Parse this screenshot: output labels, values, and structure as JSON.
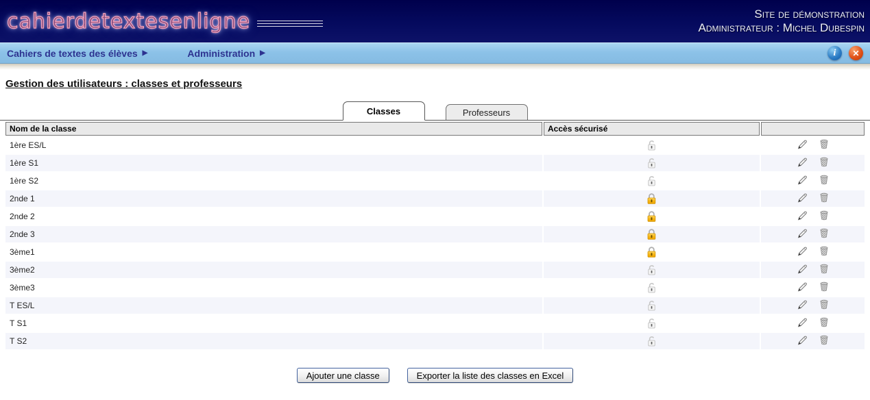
{
  "header": {
    "logo": "cahierdetextesenligne",
    "site_label": "Site de démonstration",
    "admin_label": "Administrateur : Michel Dubespin"
  },
  "menu": {
    "items": [
      {
        "label": "Cahiers de textes des élèves",
        "arrow": "▶"
      },
      {
        "label": "Administration",
        "arrow": "▶"
      }
    ],
    "icons": [
      {
        "name": "info-icon",
        "glyph": "i"
      },
      {
        "name": "close-icon",
        "glyph": "✕"
      }
    ]
  },
  "page": {
    "title": "Gestion des utilisateurs : classes et professeurs"
  },
  "tabs": [
    {
      "label": "Classes",
      "active": true
    },
    {
      "label": "Professeurs",
      "active": false
    }
  ],
  "table": {
    "columns": [
      "Nom de la classe",
      "Accès sécurisé",
      ""
    ],
    "icons": {
      "secured": "lock-closed-icon",
      "unsecured": "lock-open-icon",
      "edit": "edit-pencil-icon",
      "delete": "trash-icon"
    },
    "rows": [
      {
        "name": "1ère ES/L",
        "secured": false
      },
      {
        "name": "1ère S1",
        "secured": false
      },
      {
        "name": "1ère S2",
        "secured": false
      },
      {
        "name": "2nde 1",
        "secured": true
      },
      {
        "name": "2nde 2",
        "secured": true
      },
      {
        "name": "2nde 3",
        "secured": true
      },
      {
        "name": "3ème1",
        "secured": true
      },
      {
        "name": "3ème2",
        "secured": false
      },
      {
        "name": "3ème3",
        "secured": false
      },
      {
        "name": "T ES/L",
        "secured": false
      },
      {
        "name": "T S1",
        "secured": false
      },
      {
        "name": "T S2",
        "secured": false
      }
    ]
  },
  "buttons": {
    "add": "Ajouter une classe",
    "export": "Exporter la liste des classes en Excel"
  },
  "colors": {
    "header_navy": "#050a5e",
    "menubar_blue": "#8cc2e8",
    "menu_text_navy": "#2d3390",
    "row_alt": "#f4f5fb",
    "lock_gold": "#f5b510",
    "logo_neon_pink": "#f7a3ba"
  }
}
